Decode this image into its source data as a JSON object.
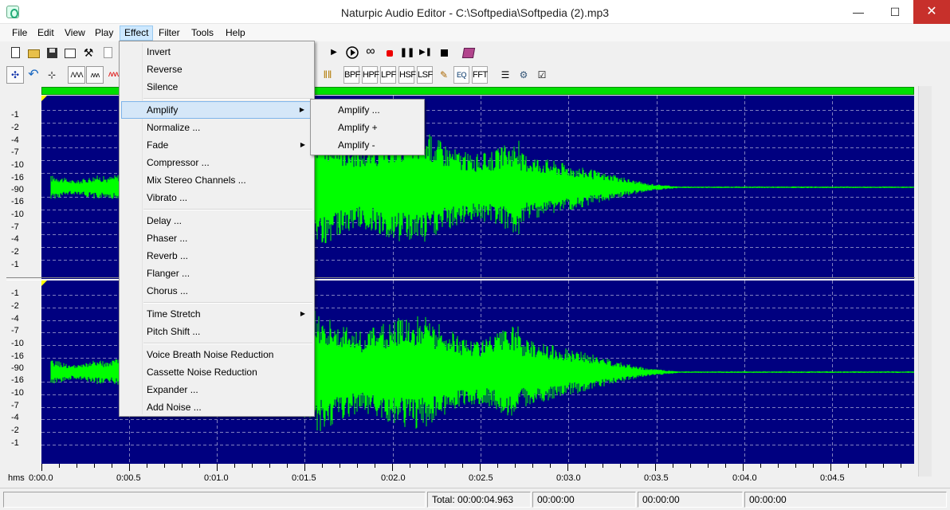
{
  "window": {
    "title": "Naturpic Audio Editor - C:\\Softpedia\\Softpedia (2).mp3",
    "min_glyph": "—",
    "max_glyph": "☐",
    "close_glyph": "✕"
  },
  "menubar": [
    "File",
    "Edit",
    "View",
    "Play",
    "Effect",
    "Filter",
    "Tools",
    "Help"
  ],
  "toolbar2_text": {
    "bpf": "BPF",
    "hpf": "HPF",
    "lpf": "LPF",
    "hsf": "HSF",
    "lsf": "LSF",
    "eq": "EQ",
    "fft": "FFT"
  },
  "effect_menu": {
    "items": {
      "invert": "Invert",
      "reverse": "Reverse",
      "silence": "Silence",
      "amplify": "Amplify",
      "normalize": "Normalize ...",
      "fade": "Fade",
      "compressor": "Compressor ...",
      "mix_stereo": "Mix Stereo Channels ...",
      "vibrato": "Vibrato ...",
      "delay": "Delay ...",
      "phaser": "Phaser ...",
      "reverb": "Reverb ...",
      "flanger": "Flanger ...",
      "chorus": "Chorus ...",
      "time_stretch": "Time Stretch",
      "pitch_shift": "Pitch Shift ...",
      "voice_breath": "Voice Breath Noise Reduction",
      "cassette": "Cassette Noise Reduction",
      "expander": "Expander ...",
      "add_noise": "Add Noise ..."
    },
    "submenu_arrow": "▶"
  },
  "amplify_submenu": [
    "Amplify ...",
    "Amplify +",
    "Amplify -"
  ],
  "db_scale": [
    "-1",
    "-2",
    "-4",
    "-7",
    "-10",
    "-16",
    "-90",
    "-16",
    "-10",
    "-7",
    "-4",
    "-2",
    "-1"
  ],
  "timeline": {
    "unit": "hms",
    "labels": [
      "0:00.0",
      "0:00.5",
      "0:01.0",
      "0:01.5",
      "0:02.0",
      "0:02.5",
      "0:03.0",
      "0:03.5",
      "0:04.0",
      "0:04.5"
    ]
  },
  "status": {
    "total": "Total: 00:00:04.963",
    "pos1": "00:00:00",
    "pos2": "00:00:00",
    "pos3": "00:00:00"
  },
  "colors": {
    "wave_bg": "#000080",
    "wave_fg": "#00ff00",
    "grid": "#8080c0"
  }
}
